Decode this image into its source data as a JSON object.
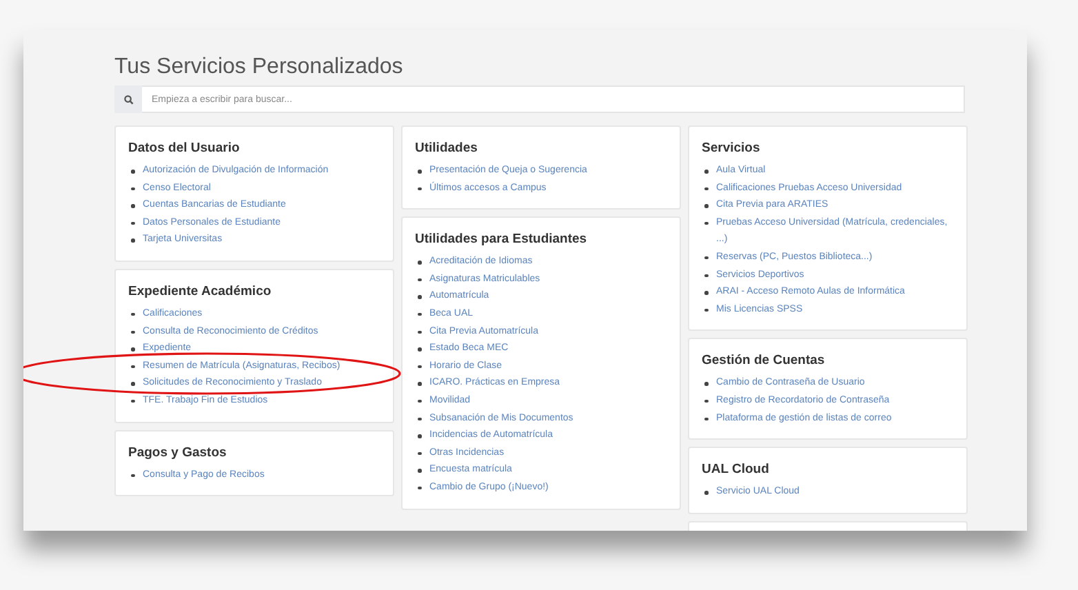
{
  "page": {
    "title": "Tus Servicios Personalizados"
  },
  "search": {
    "placeholder": "Empieza a escribir para buscar..."
  },
  "columns": [
    [
      {
        "title": "Datos del Usuario",
        "items": [
          "Autorización de Divulgación de Información",
          "Censo Electoral",
          "Cuentas Bancarias de Estudiante",
          "Datos Personales de Estudiante",
          "Tarjeta Universitas"
        ]
      },
      {
        "title": "Expediente Académico",
        "items": [
          "Calificaciones",
          "Consulta de Reconocimiento de Créditos",
          "Expediente",
          "Resumen de Matrícula (Asignaturas, Recibos)",
          "Solicitudes de Reconocimiento y Traslado",
          "TFE. Trabajo Fin de Estudios"
        ]
      },
      {
        "title": "Pagos y Gastos",
        "items": [
          "Consulta y Pago de Recibos"
        ]
      }
    ],
    [
      {
        "title": "Utilidades",
        "items": [
          "Presentación de Queja o Sugerencia",
          "Últimos accesos a Campus"
        ]
      },
      {
        "title": "Utilidades para Estudiantes",
        "items": [
          "Acreditación de Idiomas",
          "Asignaturas Matriculables",
          "Automatrícula",
          "Beca UAL",
          "Cita Previa Automatrícula",
          "Estado Beca MEC",
          "Horario de Clase",
          "ICARO. Prácticas en Empresa",
          "Movilidad",
          "Subsanación de Mis Documentos",
          "Incidencias de Automatrícula",
          "Otras Incidencias",
          "Encuesta matrícula",
          "Cambio de Grupo (¡Nuevo!)"
        ]
      }
    ],
    [
      {
        "title": "Servicios",
        "items": [
          "Aula Virtual",
          "Calificaciones Pruebas Acceso Universidad",
          "Cita Previa para ARATIES",
          "Pruebas Acceso Universidad (Matrícula, credenciales, ...)",
          "Reservas (PC, Puestos Biblioteca...)",
          "Servicios Deportivos",
          "ARAI - Acceso Remoto Aulas de Informática",
          "Mis Licencias SPSS"
        ]
      },
      {
        "title": "Gestión de Cuentas",
        "items": [
          "Cambio de Contraseña de Usuario",
          "Registro de Recordatorio de Contraseña",
          "Plataforma de gestión de listas de correo"
        ]
      },
      {
        "title": "UAL Cloud",
        "items": [
          "Servicio UAL Cloud"
        ]
      }
    ]
  ]
}
